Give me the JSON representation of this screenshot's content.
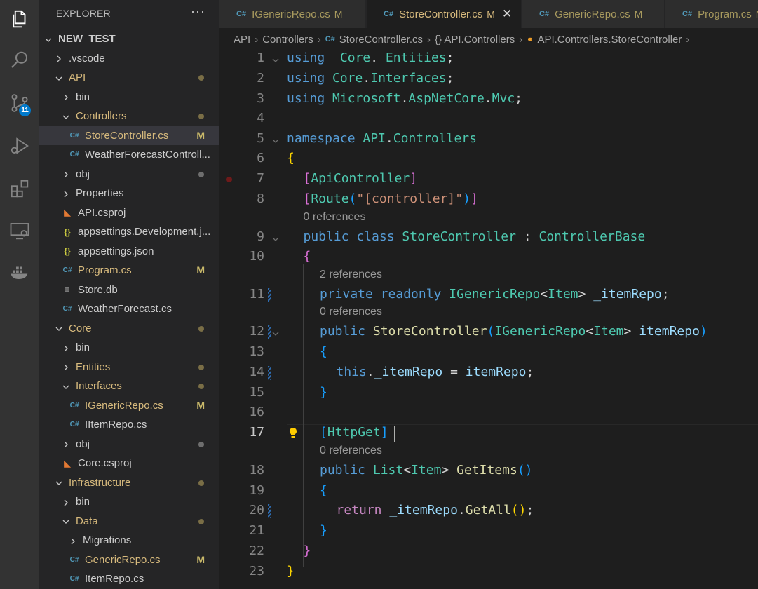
{
  "activity_bar": {
    "icons": [
      "files-icon",
      "search-icon",
      "source-control-icon",
      "run-debug-icon",
      "extensions-icon",
      "remote-explorer-icon",
      "docker-icon"
    ],
    "source_control_badge": "11",
    "accent": "#007acc"
  },
  "explorer": {
    "title": "EXPLORER",
    "more": "···",
    "items": [
      {
        "label": "NEW_TEST",
        "kind": "root",
        "open": true,
        "depth": 0
      },
      {
        "label": ".vscode",
        "kind": "folder",
        "open": false,
        "depth": 1
      },
      {
        "label": "API",
        "kind": "folder",
        "open": true,
        "depth": 1,
        "modified": true
      },
      {
        "label": "bin",
        "kind": "folder",
        "open": false,
        "depth": 2
      },
      {
        "label": "Controllers",
        "kind": "folder",
        "open": true,
        "depth": 2,
        "modified": true
      },
      {
        "label": "StoreController.cs",
        "kind": "cs",
        "depth": 3,
        "status": "M",
        "selected": true
      },
      {
        "label": "WeatherForecastControll...",
        "kind": "cs",
        "depth": 3
      },
      {
        "label": "obj",
        "kind": "folder",
        "open": false,
        "depth": 2,
        "dot": true
      },
      {
        "label": "Properties",
        "kind": "folder",
        "open": false,
        "depth": 2
      },
      {
        "label": "API.csproj",
        "kind": "rss",
        "depth": 2
      },
      {
        "label": "appsettings.Development.j...",
        "kind": "json",
        "depth": 2
      },
      {
        "label": "appsettings.json",
        "kind": "json",
        "depth": 2
      },
      {
        "label": "Program.cs",
        "kind": "cs",
        "depth": 2,
        "status": "M"
      },
      {
        "label": "Store.db",
        "kind": "db",
        "depth": 2
      },
      {
        "label": "WeatherForecast.cs",
        "kind": "cs",
        "depth": 2
      },
      {
        "label": "Core",
        "kind": "folder",
        "open": true,
        "depth": 1,
        "modified": true
      },
      {
        "label": "bin",
        "kind": "folder",
        "open": false,
        "depth": 2
      },
      {
        "label": "Entities",
        "kind": "folder",
        "open": false,
        "depth": 2,
        "modified": true
      },
      {
        "label": "Interfaces",
        "kind": "folder",
        "open": true,
        "depth": 2,
        "modified": true
      },
      {
        "label": "IGenericRepo.cs",
        "kind": "cs",
        "depth": 3,
        "status": "M"
      },
      {
        "label": "IItemRepo.cs",
        "kind": "cs",
        "depth": 3
      },
      {
        "label": "obj",
        "kind": "folder",
        "open": false,
        "depth": 2,
        "dot": true
      },
      {
        "label": "Core.csproj",
        "kind": "rss",
        "depth": 2
      },
      {
        "label": "Infrastructure",
        "kind": "folder",
        "open": true,
        "depth": 1,
        "modified": true
      },
      {
        "label": "bin",
        "kind": "folder",
        "open": false,
        "depth": 2
      },
      {
        "label": "Data",
        "kind": "folder",
        "open": true,
        "depth": 2,
        "modified": true
      },
      {
        "label": "Migrations",
        "kind": "folder",
        "open": false,
        "depth": 3
      },
      {
        "label": "GenericRepo.cs",
        "kind": "cs",
        "depth": 3,
        "status": "M"
      },
      {
        "label": "ItemRepo.cs",
        "kind": "cs",
        "depth": 3
      }
    ]
  },
  "tabs": [
    {
      "icon": "C#",
      "label": "IGenericRepo.cs",
      "status": "M",
      "active": false
    },
    {
      "icon": "C#",
      "label": "StoreController.cs",
      "status": "M",
      "active": true,
      "close": "✕"
    },
    {
      "icon": "C#",
      "label": "GenericRepo.cs",
      "status": "M",
      "active": false
    },
    {
      "icon": "C#",
      "label": "Program.cs",
      "status": "M",
      "active": false
    }
  ],
  "breadcrumb": [
    "API",
    "Controllers",
    "StoreController.cs",
    "{} API.Controllers",
    "API.Controllers.StoreController"
  ],
  "editor": {
    "current_line": 17,
    "lines": [
      {
        "n": "1",
        "tokens": [
          [
            "k",
            "using"
          ],
          [
            "",
            "  "
          ],
          [
            "t",
            "Core"
          ],
          [
            "",
            ". "
          ],
          [
            "t",
            "Entities"
          ],
          [
            "",
            ";"
          ]
        ]
      },
      {
        "n": "2",
        "tokens": [
          [
            "k",
            "using"
          ],
          [
            "",
            " "
          ],
          [
            "t",
            "Core"
          ],
          [
            "",
            "."
          ],
          [
            "t",
            "Interfaces"
          ],
          [
            "",
            ";"
          ]
        ]
      },
      {
        "n": "3",
        "tokens": [
          [
            "k",
            "using"
          ],
          [
            "",
            " "
          ],
          [
            "t",
            "Microsoft"
          ],
          [
            "",
            "."
          ],
          [
            "t",
            "AspNetCore"
          ],
          [
            "",
            "."
          ],
          [
            "t",
            "Mvc"
          ],
          [
            "",
            ";"
          ]
        ]
      },
      {
        "n": "4",
        "tokens": []
      },
      {
        "n": "5",
        "tokens": [
          [
            "k",
            "namespace"
          ],
          [
            "",
            " "
          ],
          [
            "t",
            "API"
          ],
          [
            "",
            "."
          ],
          [
            "t",
            "Controllers"
          ]
        ]
      },
      {
        "n": "6",
        "tokens": [
          [
            "by",
            "{"
          ]
        ]
      },
      {
        "n": "7",
        "tokens": [
          [
            "",
            ""
          ],
          [
            "bp",
            "["
          ],
          [
            "t",
            "ApiController"
          ],
          [
            "bp",
            "]"
          ]
        ]
      },
      {
        "n": "8",
        "tokens": [
          [
            "bp",
            "["
          ],
          [
            "t",
            "Route"
          ],
          [
            "bb",
            "("
          ],
          [
            "s",
            "\"[controller]\""
          ],
          [
            "bb",
            ")"
          ],
          [
            "bp",
            "]"
          ]
        ]
      },
      {
        "n": "9",
        "tokens": [
          [
            "k",
            "public"
          ],
          [
            "",
            " "
          ],
          [
            "k",
            "class"
          ],
          [
            "",
            " "
          ],
          [
            "t",
            "StoreController"
          ],
          [
            "",
            " : "
          ],
          [
            "t",
            "ControllerBase"
          ]
        ]
      },
      {
        "n": "10",
        "tokens": [
          [
            "bp",
            "{"
          ]
        ]
      },
      {
        "n": "11",
        "tokens": [
          [
            "k",
            "private"
          ],
          [
            "",
            " "
          ],
          [
            "k",
            "readonly"
          ],
          [
            "",
            " "
          ],
          [
            "t",
            "IGenericRepo"
          ],
          [
            "",
            "<"
          ],
          [
            "t",
            "Item"
          ],
          [
            "",
            "> "
          ],
          [
            "v",
            "_itemRepo"
          ],
          [
            "",
            ";"
          ]
        ]
      },
      {
        "n": "12",
        "tokens": [
          [
            "k",
            "public"
          ],
          [
            "",
            " "
          ],
          [
            "f",
            "StoreController"
          ],
          [
            "bb",
            "("
          ],
          [
            "t",
            "IGenericRepo"
          ],
          [
            "",
            "<"
          ],
          [
            "t",
            "Item"
          ],
          [
            "",
            "> "
          ],
          [
            "v",
            "itemRepo"
          ],
          [
            "bb",
            ")"
          ]
        ]
      },
      {
        "n": "13",
        "tokens": [
          [
            "bb",
            "{"
          ]
        ]
      },
      {
        "n": "14",
        "tokens": [
          [
            "k",
            "this"
          ],
          [
            "",
            "."
          ],
          [
            "v",
            "_itemRepo"
          ],
          [
            "",
            " = "
          ],
          [
            "v",
            "itemRepo"
          ],
          [
            "",
            ";"
          ]
        ]
      },
      {
        "n": "15",
        "tokens": [
          [
            "bb",
            "}"
          ]
        ]
      },
      {
        "n": "16",
        "tokens": []
      },
      {
        "n": "17",
        "tokens": [
          [
            "bb",
            "["
          ],
          [
            "t",
            "HttpGet"
          ],
          [
            "bb",
            "]"
          ]
        ]
      },
      {
        "n": "18",
        "tokens": [
          [
            "k",
            "public"
          ],
          [
            "",
            " "
          ],
          [
            "t",
            "List"
          ],
          [
            "",
            "<"
          ],
          [
            "t",
            "Item"
          ],
          [
            "",
            "> "
          ],
          [
            "f",
            "GetItems"
          ],
          [
            "bb",
            "()"
          ]
        ]
      },
      {
        "n": "19",
        "tokens": [
          [
            "bb",
            "{"
          ]
        ]
      },
      {
        "n": "20",
        "tokens": [
          [
            "c",
            "return"
          ],
          [
            "",
            " "
          ],
          [
            "v",
            "_itemRepo"
          ],
          [
            "",
            "."
          ],
          [
            "f",
            "GetAll"
          ],
          [
            "by",
            "()"
          ],
          [
            "",
            ";"
          ]
        ]
      },
      {
        "n": "21",
        "tokens": [
          [
            "bb",
            "}"
          ]
        ]
      },
      {
        "n": "22",
        "tokens": [
          [
            "bp",
            "}"
          ]
        ]
      },
      {
        "n": "23",
        "tokens": [
          [
            "by",
            "}"
          ]
        ]
      }
    ],
    "codelens": [
      "0 references",
      "2 references",
      "0 references",
      "0 references"
    ]
  }
}
